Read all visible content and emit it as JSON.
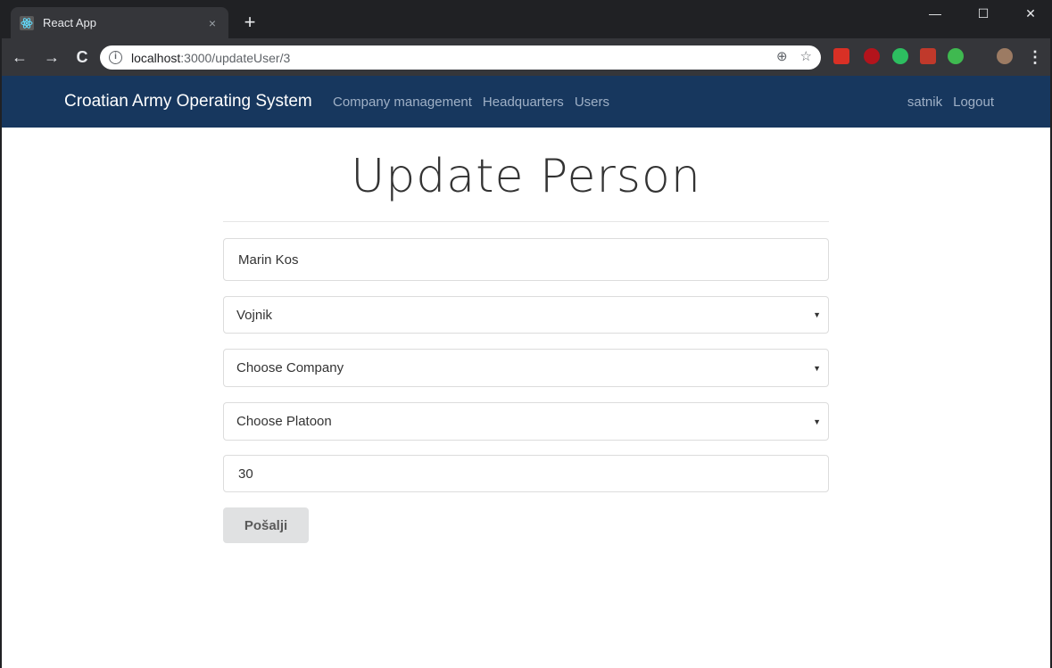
{
  "browser": {
    "tab_title": "React App",
    "tab_close": "×",
    "new_tab": "+",
    "url_host": "localhost",
    "url_path": ":3000/updateUser/3",
    "window_minimize": "—",
    "window_maximize": "☐",
    "window_close": "✕"
  },
  "navbar": {
    "brand": "Croatian Army Operating System",
    "links": [
      "Company management",
      "Headquarters",
      "Users"
    ],
    "user": "satnik",
    "logout": "Logout"
  },
  "form": {
    "title": "Update Person",
    "name_value": "Marin Kos",
    "rank_value": "Vojnik",
    "company_placeholder": "Choose Company",
    "platoon_placeholder": "Choose Platoon",
    "number_value": "30",
    "submit_label": "Pošalji"
  },
  "colors": {
    "navbar_bg": "#17375e",
    "chrome_bg": "#202124"
  }
}
